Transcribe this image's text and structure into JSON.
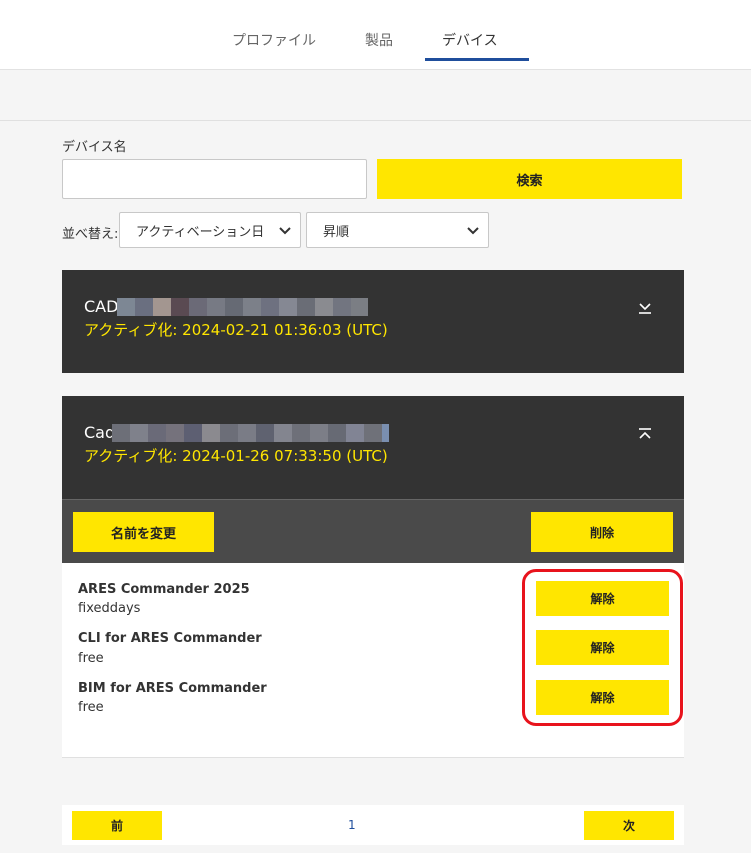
{
  "tabs": [
    {
      "label": "プロファイル",
      "active": false
    },
    {
      "label": "製品",
      "active": false
    },
    {
      "label": "デバイス",
      "active": true
    }
  ],
  "search": {
    "label": "デバイス名",
    "value": "",
    "button": "検索"
  },
  "sort": {
    "label": "並べ替え:",
    "field_value": "アクティベーション日",
    "order_value": "昇順"
  },
  "devices": [
    {
      "name_prefix": "CAD",
      "activated": "アクティブ化: 2024-02-21 01:36:03 (UTC)",
      "expanded": false
    },
    {
      "name_prefix": "Cad",
      "activated": "アクティブ化: 2024-01-26 07:33:50 (UTC)",
      "expanded": true,
      "rename_button": "名前を変更",
      "delete_button": "削除",
      "licenses": [
        {
          "name": "ARES Commander 2025",
          "type": "fixeddays",
          "button": "解除"
        },
        {
          "name": "CLI for ARES Commander",
          "type": "free",
          "button": "解除"
        },
        {
          "name": "BIM for ARES Commander",
          "type": "free",
          "button": "解除"
        }
      ]
    }
  ],
  "pagination": {
    "prev": "前",
    "page": "1",
    "next": "次"
  },
  "colors": {
    "accent_yellow": "#ffe600",
    "dark_panel": "#333333",
    "highlight_red": "#e8131c",
    "tab_underline": "#1f4e9c"
  }
}
